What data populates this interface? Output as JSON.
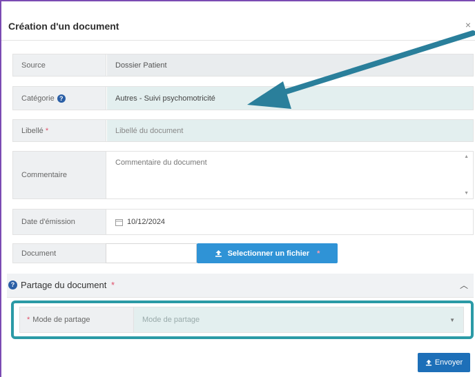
{
  "modal": {
    "title": "Création d'un document",
    "close": "×"
  },
  "fields": {
    "source": {
      "label": "Source",
      "value": "Dossier Patient"
    },
    "categorie": {
      "label": "Catégorie",
      "help": "?",
      "value": "Autres - Suivi psychomotricité"
    },
    "libelle": {
      "label": "Libellé",
      "required": "*",
      "placeholder": "Libellé du document"
    },
    "commentaire": {
      "label": "Commentaire",
      "placeholder": "Commentaire du document"
    },
    "date": {
      "label": "Date d'émission",
      "icon": "calendar-icon",
      "value": "10/12/2024"
    },
    "document": {
      "label": "Document",
      "button": "Selectionner un fichier",
      "required": "*"
    }
  },
  "section": {
    "title": "Partage du document",
    "required": "*",
    "help": "?"
  },
  "mode": {
    "required": "*",
    "label": "Mode de partage",
    "placeholder": "Mode de partage"
  },
  "send": {
    "label": "Envoyer"
  },
  "colors": {
    "accent": "#2f93d6",
    "highlight": "#2b9aa6",
    "border": "#7b4bb3"
  }
}
